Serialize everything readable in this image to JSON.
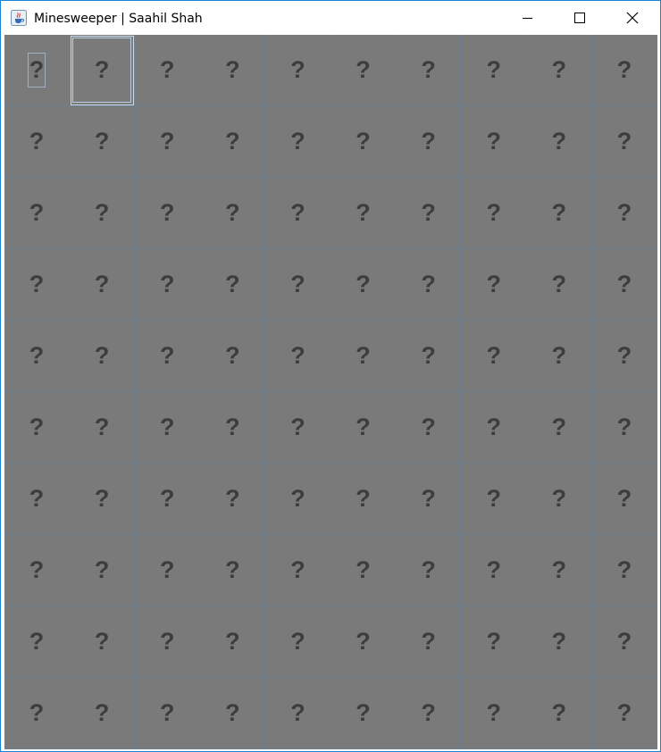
{
  "window": {
    "title": "Minesweeper | Saahil Shah",
    "icon": "java-coffee-icon",
    "controls": [
      "minimize-icon",
      "maximize-icon",
      "close-icon"
    ]
  },
  "board": {
    "rows": 10,
    "columns": 10,
    "cell_label": "?",
    "focused_cell": {
      "row": 0,
      "col": 0
    },
    "selected_cell": {
      "row": 0,
      "col": 1
    }
  },
  "colors": {
    "window_border": "#1883d7",
    "cell_background": "#7a7a7a",
    "cell_grid": "#6b7f93",
    "cell_text": "#3d3d3d"
  }
}
